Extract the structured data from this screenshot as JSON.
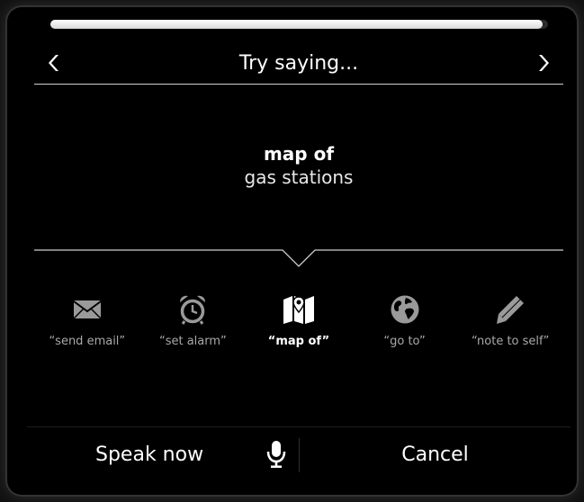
{
  "progress": {
    "fraction": 0.99
  },
  "header": {
    "title": "Try saying...",
    "prev_icon": "chevron-left-icon",
    "next_icon": "chevron-right-icon"
  },
  "example": {
    "command": "map of",
    "argument": "gas stations"
  },
  "commands": [
    {
      "label": "“send email”",
      "icon": "envelope-icon",
      "active": false
    },
    {
      "label": "“set alarm”",
      "icon": "alarm-clock-icon",
      "active": false
    },
    {
      "label": "“map of”",
      "icon": "map-icon",
      "active": true
    },
    {
      "label": "“go to”",
      "icon": "globe-icon",
      "active": false
    },
    {
      "label": "“note to self”",
      "icon": "pencil-icon",
      "active": false
    }
  ],
  "footer": {
    "speak_label": "Speak now",
    "mic_icon": "microphone-icon",
    "cancel_label": "Cancel"
  },
  "colors": {
    "background": "#000000",
    "text": "#ffffff",
    "muted_text": "#a9a9a9",
    "rule": "#cfcfcf"
  }
}
